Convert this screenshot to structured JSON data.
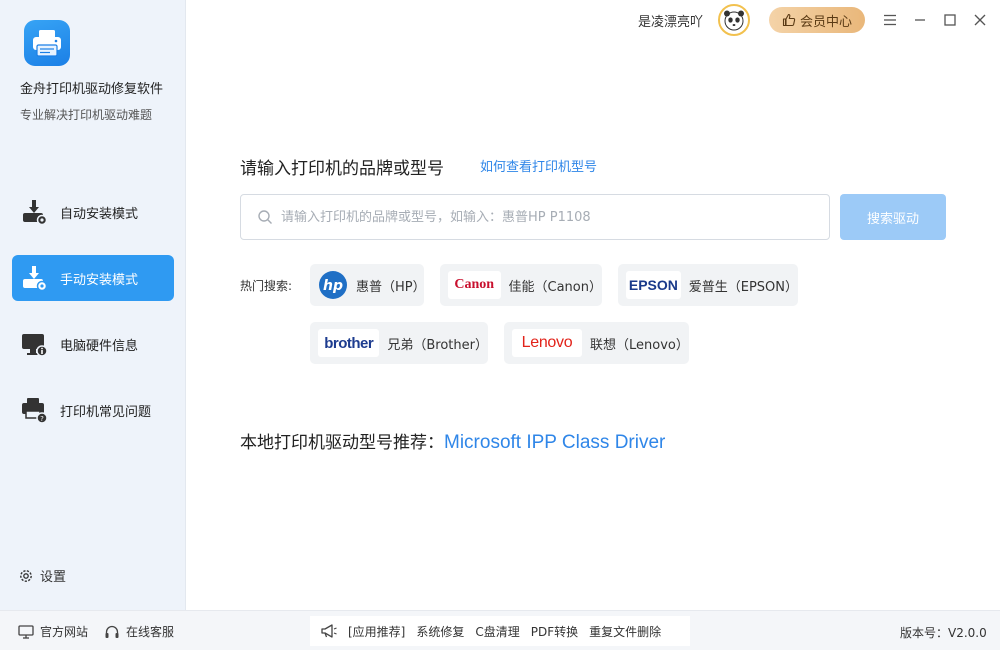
{
  "app": {
    "title": "金舟打印机驱动修复软件",
    "subtitle": "专业解决打印机驱动难题"
  },
  "sidebar": {
    "items": [
      {
        "label": "自动安装模式",
        "icon": "auto-install-icon",
        "active": false
      },
      {
        "label": "手动安装模式",
        "icon": "manual-install-icon",
        "active": true
      },
      {
        "label": "电脑硬件信息",
        "icon": "hardware-info-icon",
        "active": false
      },
      {
        "label": "打印机常见问题",
        "icon": "printer-faq-icon",
        "active": false
      }
    ],
    "settings_label": "设置"
  },
  "titlebar": {
    "username": "是凌漂亮吖",
    "vip_label": "会员中心"
  },
  "main": {
    "title": "请输入打印机的品牌或型号",
    "help_link": "如何查看打印机型号",
    "search_placeholder": "请输入打印机的品牌或型号，如输入：惠普HP P1108",
    "search_value": "",
    "search_button": "搜索驱动",
    "hot_label": "热门搜索:",
    "brands": [
      {
        "logo_text": "hp",
        "name": "惠普（HP）"
      },
      {
        "logo_text": "Canon",
        "name": "佳能（Canon）"
      },
      {
        "logo_text": "EPSON",
        "name": "爱普生（EPSON）"
      },
      {
        "logo_text": "brother",
        "name": "兄弟（Brother）"
      },
      {
        "logo_text": "Lenovo",
        "name": "联想（Lenovo）"
      }
    ],
    "local_label": "本地打印机驱动型号推荐：",
    "local_driver": "Microsoft IPP Class Driver"
  },
  "footer": {
    "website": "官方网站",
    "service": "在线客服",
    "rec_label": "[应用推荐]",
    "rec_items": [
      "系统修复",
      "C盘清理",
      "PDF转换",
      "重复文件删除"
    ],
    "version": "版本号：V2.0.0"
  },
  "colors": {
    "accent": "#2f9af2",
    "link": "#2f86e8",
    "sidebar_bg": "#eef3fa",
    "vip_gradient_start": "#f4d3a8",
    "vip_gradient_end": "#e9b77a"
  }
}
